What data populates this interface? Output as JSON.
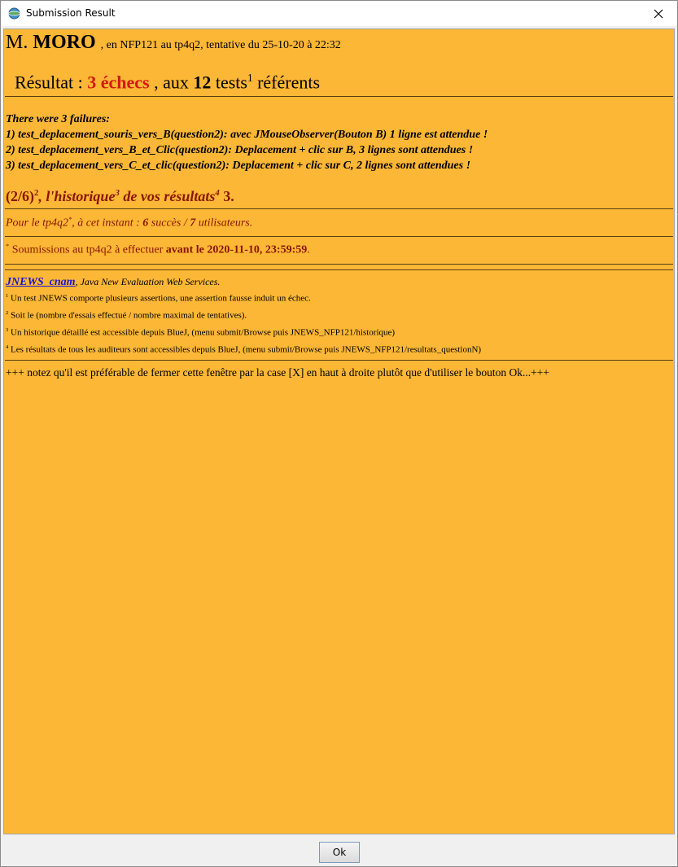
{
  "window": {
    "title": "Submission Result"
  },
  "header": {
    "prefix": "M.",
    "name": "MORO",
    "context": ", en NFP121 au tp4q2, tentative du 25-10-20 à 22:32"
  },
  "result": {
    "label": "Résultat :",
    "failures": "3 échecs",
    "mid": ", aux",
    "tests_count": "12",
    "tests_word": "tests",
    "tests_sup": "1",
    "end": "référents"
  },
  "failures": {
    "heading": "There were 3 failures:",
    "items": [
      "1) test_deplacement_souris_vers_B(question2): avec JMouseObserver(Bouton B) 1 ligne est attendue !",
      "2) test_deplacement_vers_B_et_Clic(question2): Deplacement + clic sur B, 3 lignes sont attendues !",
      "3) test_deplacement_vers_C_et_clic(question2): Deplacement + clic sur C, 2 lignes sont attendues !"
    ]
  },
  "history": {
    "ratio": "(2/6)",
    "ratio_sup": "2",
    "text1": ", l'historique",
    "sup3": "3",
    "text2": " de vos résultats",
    "sup4": "4",
    "value": " 3."
  },
  "stats": {
    "prefix": "Pour le tp4q2",
    "star": "*",
    "mid": ", à cet instant :",
    "success": "6",
    "success_label": "succès /",
    "users": "7",
    "users_label": "utilisateurs."
  },
  "deadline": {
    "star": "*",
    "text": "Soumissions au tp4q2 à effectuer",
    "bold": "avant le 2020-11-10, 23:59:59",
    "end": "."
  },
  "notes": {
    "link": "JNEWS_cnam",
    "link_desc": ", Java New Evaluation Web Services.",
    "items": [
      {
        "num": "1",
        "text": "Un test JNEWS comporte plusieurs assertions, une assertion fausse induit un échec."
      },
      {
        "num": "2",
        "text": "Soit le (nombre d'essais effectué / nombre maximal de tentatives)."
      },
      {
        "num": "3",
        "text": "Un historique détaillé est accessible depuis BlueJ, (menu submit/Browse puis JNEWS_NFP121/historique)"
      },
      {
        "num": "4",
        "text": "Les résultats de tous les auditeurs sont accessibles depuis BlueJ, (menu submit/Browse puis JNEWS_NFP121/resultats_questionN)"
      }
    ]
  },
  "footer_note": "+++ notez qu'il est préférable de fermer cette fenêtre par la case [X] en haut à droite plutôt que d'utiliser le bouton Ok...+++",
  "buttons": {
    "ok": "Ok"
  },
  "colors": {
    "background": "#fbb735",
    "accent_red": "#d41a0c",
    "dark_red": "#8a1600",
    "link": "#1a14d8"
  },
  "icons": [
    "app-globe-icon",
    "close-icon"
  ]
}
